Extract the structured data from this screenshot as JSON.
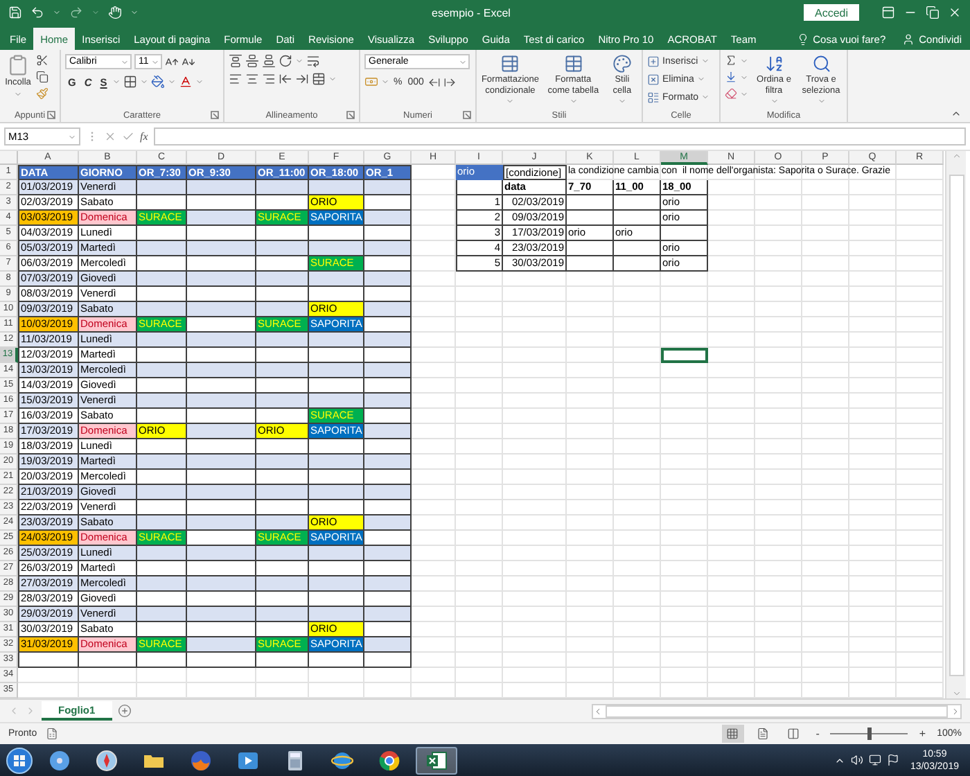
{
  "window": {
    "title": "esempio - Excel",
    "sign_in": "Accedi"
  },
  "tabs": [
    {
      "label": "File",
      "selected": false
    },
    {
      "label": "Home",
      "selected": true
    },
    {
      "label": "Inserisci",
      "selected": false
    },
    {
      "label": "Layout di pagina",
      "selected": false
    },
    {
      "label": "Formule",
      "selected": false
    },
    {
      "label": "Dati",
      "selected": false
    },
    {
      "label": "Revisione",
      "selected": false
    },
    {
      "label": "Visualizza",
      "selected": false
    },
    {
      "label": "Sviluppo",
      "selected": false
    },
    {
      "label": "Guida",
      "selected": false
    },
    {
      "label": "Test di carico",
      "selected": false
    },
    {
      "label": "Nitro Pro 10",
      "selected": false
    },
    {
      "label": "ACROBAT",
      "selected": false
    },
    {
      "label": "Team",
      "selected": false
    }
  ],
  "tell_me": "Cosa vuoi fare?",
  "share": "Condividi",
  "ribbon": {
    "clipboard": {
      "title": "Appunti",
      "paste": "Incolla"
    },
    "font": {
      "title": "Carattere",
      "font": "Calibri",
      "size": "11",
      "bold": "G",
      "italic": "C",
      "underline": "S"
    },
    "alignment": {
      "title": "Allineamento"
    },
    "number": {
      "title": "Numeri",
      "format": "Generale",
      "percent": "%",
      "thousands": "000"
    },
    "styles": {
      "title": "Stili",
      "buttons": [
        "Formattazione condizionale",
        "Formatta come tabella",
        "Stili cella"
      ]
    },
    "cells": {
      "title": "Celle",
      "buttons": [
        "Inserisci",
        "Elimina",
        "Formato"
      ]
    },
    "editing": {
      "title": "Modifica",
      "buttons": [
        "Ordina e filtra",
        "Trova e seleziona"
      ]
    }
  },
  "formula_bar": {
    "name_box": "M13",
    "fx": "fx"
  },
  "sheet": {
    "columns": [
      {
        "label": "A",
        "selected": false
      },
      {
        "label": "B",
        "selected": false
      },
      {
        "label": "C",
        "selected": false
      },
      {
        "label": "D",
        "selected": false
      },
      {
        "label": "E",
        "selected": false
      },
      {
        "label": "F",
        "selected": false
      },
      {
        "label": "G",
        "selected": false
      },
      {
        "label": "H",
        "selected": false
      },
      {
        "label": "I",
        "selected": false
      },
      {
        "label": "J",
        "selected": false
      },
      {
        "label": "K",
        "selected": false
      },
      {
        "label": "L",
        "selected": false
      },
      {
        "label": "M",
        "selected": true
      },
      {
        "label": "N",
        "selected": false
      },
      {
        "label": "O",
        "selected": false
      },
      {
        "label": "P",
        "selected": false
      },
      {
        "label": "Q",
        "selected": false
      },
      {
        "label": "R",
        "selected": false
      }
    ],
    "rows": [
      {
        "label": "1",
        "selected": false
      },
      {
        "label": "2",
        "selected": false
      },
      {
        "label": "3",
        "selected": false
      },
      {
        "label": "4",
        "selected": false
      },
      {
        "label": "5",
        "selected": false
      },
      {
        "label": "6",
        "selected": false
      },
      {
        "label": "7",
        "selected": false
      },
      {
        "label": "8",
        "selected": false
      },
      {
        "label": "9",
        "selected": false
      },
      {
        "label": "10",
        "selected": false
      },
      {
        "label": "11",
        "selected": false
      },
      {
        "label": "12",
        "selected": false
      },
      {
        "label": "13",
        "selected": true
      },
      {
        "label": "14",
        "selected": false
      },
      {
        "label": "15",
        "selected": false
      },
      {
        "label": "16",
        "selected": false
      },
      {
        "label": "17",
        "selected": false
      },
      {
        "label": "18",
        "selected": false
      },
      {
        "label": "19",
        "selected": false
      },
      {
        "label": "20",
        "selected": false
      },
      {
        "label": "21",
        "selected": false
      },
      {
        "label": "22",
        "selected": false
      },
      {
        "label": "23",
        "selected": false
      },
      {
        "label": "24",
        "selected": false
      },
      {
        "label": "25",
        "selected": false
      },
      {
        "label": "26",
        "selected": false
      },
      {
        "label": "27",
        "selected": false
      },
      {
        "label": "28",
        "selected": false
      },
      {
        "label": "29",
        "selected": false
      },
      {
        "label": "30",
        "selected": false
      },
      {
        "label": "31",
        "selected": false
      },
      {
        "label": "32",
        "selected": false
      },
      {
        "label": "33",
        "selected": false
      },
      {
        "label": "34",
        "selected": false
      },
      {
        "label": "35",
        "selected": false
      }
    ],
    "schedule": {
      "header": [
        "DATA",
        "GIORNO",
        "OR_7:30",
        "OR_9:30",
        "OR_11:00",
        "OR_18:00",
        "OR_1"
      ],
      "rows": [
        {
          "cells": [
            "01/03/2019",
            "Venerdì",
            null,
            null,
            null,
            null,
            null
          ]
        },
        {
          "cells": [
            "02/03/2019",
            "Sabato",
            null,
            null,
            null,
            {
              "text": "ORIO",
              "color": "#ffff00"
            },
            null
          ]
        },
        {
          "cells": [
            {
              "text": "03/03/2019",
              "color": "#ffc000"
            },
            {
              "text": "Domenica",
              "color": "#ffc7ce"
            },
            {
              "text": "SURACE",
              "color": "#00b050"
            },
            null,
            {
              "text": "SURACE",
              "color": "#00b050"
            },
            {
              "text": "SAPORITA",
              "color": "#0070c0"
            },
            null
          ]
        },
        {
          "cells": [
            "04/03/2019",
            "Lunedì",
            null,
            null,
            null,
            null,
            null
          ]
        },
        {
          "cells": [
            "05/03/2019",
            "Martedì",
            null,
            null,
            null,
            null,
            null
          ]
        },
        {
          "cells": [
            "06/03/2019",
            "Mercoledì",
            null,
            null,
            null,
            {
              "text": "SURACE",
              "color": "#00b050"
            },
            null
          ]
        },
        {
          "cells": [
            "07/03/2019",
            "Giovedì",
            null,
            null,
            null,
            null,
            null
          ]
        },
        {
          "cells": [
            "08/03/2019",
            "Venerdì",
            null,
            null,
            null,
            null,
            null
          ]
        },
        {
          "cells": [
            "09/03/2019",
            "Sabato",
            null,
            null,
            null,
            {
              "text": "ORIO",
              "color": "#ffff00"
            },
            null
          ]
        },
        {
          "cells": [
            {
              "text": "10/03/2019",
              "color": "#ffc000"
            },
            {
              "text": "Domenica",
              "color": "#ffc7ce"
            },
            {
              "text": "SURACE",
              "color": "#00b050"
            },
            null,
            {
              "text": "SURACE",
              "color": "#00b050"
            },
            {
              "text": "SAPORITA",
              "color": "#0070c0"
            },
            null
          ]
        },
        {
          "cells": [
            "11/03/2019",
            "Lunedì",
            null,
            null,
            null,
            null,
            null
          ]
        },
        {
          "cells": [
            "12/03/2019",
            "Martedì",
            null,
            null,
            null,
            null,
            null
          ]
        },
        {
          "cells": [
            "13/03/2019",
            "Mercoledì",
            null,
            null,
            null,
            null,
            null
          ]
        },
        {
          "cells": [
            "14/03/2019",
            "Giovedì",
            null,
            null,
            null,
            null,
            null
          ]
        },
        {
          "cells": [
            "15/03/2019",
            "Venerdì",
            null,
            null,
            null,
            null,
            null
          ]
        },
        {
          "cells": [
            "16/03/2019",
            "Sabato",
            null,
            null,
            null,
            {
              "text": "SURACE",
              "color": "#00b050"
            },
            null
          ]
        },
        {
          "cells": [
            "17/03/2019",
            {
              "text": "Domenica",
              "color": "#ffc7ce"
            },
            {
              "text": "ORIO",
              "color": "#ffff00"
            },
            null,
            {
              "text": "ORIO",
              "color": "#ffff00"
            },
            {
              "text": "SAPORITA",
              "color": "#0070c0"
            },
            null
          ]
        },
        {
          "cells": [
            "18/03/2019",
            "Lunedì",
            null,
            null,
            null,
            null,
            null
          ]
        },
        {
          "cells": [
            "19/03/2019",
            "Martedì",
            null,
            null,
            null,
            null,
            null
          ]
        },
        {
          "cells": [
            "20/03/2019",
            "Mercoledì",
            null,
            null,
            null,
            null,
            null
          ]
        },
        {
          "cells": [
            "21/03/2019",
            "Giovedì",
            null,
            null,
            null,
            null,
            null
          ]
        },
        {
          "cells": [
            "22/03/2019",
            "Venerdì",
            null,
            null,
            null,
            null,
            null
          ]
        },
        {
          "cells": [
            "23/03/2019",
            "Sabato",
            null,
            null,
            null,
            {
              "text": "ORIO",
              "color": "#ffff00"
            },
            null
          ]
        },
        {
          "cells": [
            {
              "text": "24/03/2019",
              "color": "#ffc000"
            },
            {
              "text": "Domenica",
              "color": "#ffc7ce"
            },
            {
              "text": "SURACE",
              "color": "#00b050"
            },
            null,
            {
              "text": "SURACE",
              "color": "#00b050"
            },
            {
              "text": "SAPORITA",
              "color": "#0070c0"
            },
            null
          ]
        },
        {
          "cells": [
            "25/03/2019",
            "Lunedì",
            null,
            null,
            null,
            null,
            null
          ]
        },
        {
          "cells": [
            "26/03/2019",
            "Martedì",
            null,
            null,
            null,
            null,
            null
          ]
        },
        {
          "cells": [
            "27/03/2019",
            "Mercoledì",
            null,
            null,
            null,
            null,
            null
          ]
        },
        {
          "cells": [
            "28/03/2019",
            "Giovedì",
            null,
            null,
            null,
            null,
            null
          ]
        },
        {
          "cells": [
            "29/03/2019",
            "Venerdì",
            null,
            null,
            null,
            null,
            null
          ]
        },
        {
          "cells": [
            "30/03/2019",
            "Sabato",
            null,
            null,
            null,
            {
              "text": "ORIO",
              "color": "#ffff00"
            },
            null
          ]
        },
        {
          "cells": [
            {
              "text": "31/03/2019",
              "color": "#ffc000"
            },
            {
              "text": "Domenica",
              "color": "#ffc7ce"
            },
            {
              "text": "SURACE",
              "color": "#00b050"
            },
            null,
            {
              "text": "SURACE",
              "color": "#00b050"
            },
            {
              "text": "SAPORITA",
              "color": "#0070c0"
            },
            null
          ]
        },
        {
          "cells": [
            null,
            null,
            null,
            null,
            null,
            null,
            null
          ]
        }
      ]
    },
    "side_table": {
      "tag": "orio",
      "condition": "[condizione]",
      "note": "la condizione cambia con  il nome dell'organista: Saporita o Surace. Grazie",
      "header": [
        "data",
        "7_70",
        "11_00",
        "18_00"
      ],
      "rows": [
        {
          "cells": [
            "1",
            "02/03/2019",
            null,
            null,
            "orio"
          ]
        },
        {
          "cells": [
            "2",
            "09/03/2019",
            null,
            null,
            "orio"
          ]
        },
        {
          "cells": [
            "3",
            "17/03/2019",
            "orio",
            "orio",
            null
          ]
        },
        {
          "cells": [
            "4",
            "23/03/2019",
            null,
            null,
            "orio"
          ]
        },
        {
          "cells": [
            "5",
            "30/03/2019",
            null,
            null,
            "orio"
          ]
        }
      ]
    }
  },
  "sheet_tabs": [
    {
      "label": "Foglio1",
      "selected": true
    }
  ],
  "status_bar": {
    "status": "Pronto",
    "zoom": {
      "minus": "-",
      "plus": "+",
      "level": 0.5,
      "reading": "100%"
    }
  },
  "taskbar": {
    "apps": [
      {
        "kind": "disc",
        "selected": false
      },
      {
        "kind": "compass",
        "selected": false
      },
      {
        "kind": "folder",
        "selected": false
      },
      {
        "kind": "fox",
        "selected": false
      },
      {
        "kind": "player",
        "selected": false
      },
      {
        "kind": "calculator",
        "selected": false
      },
      {
        "kind": "globe",
        "selected": false
      },
      {
        "kind": "wheel",
        "selected": false
      },
      {
        "kind": "spreadsheet",
        "selected": true
      }
    ],
    "time": "10:59",
    "date": "13/03/2019"
  }
}
